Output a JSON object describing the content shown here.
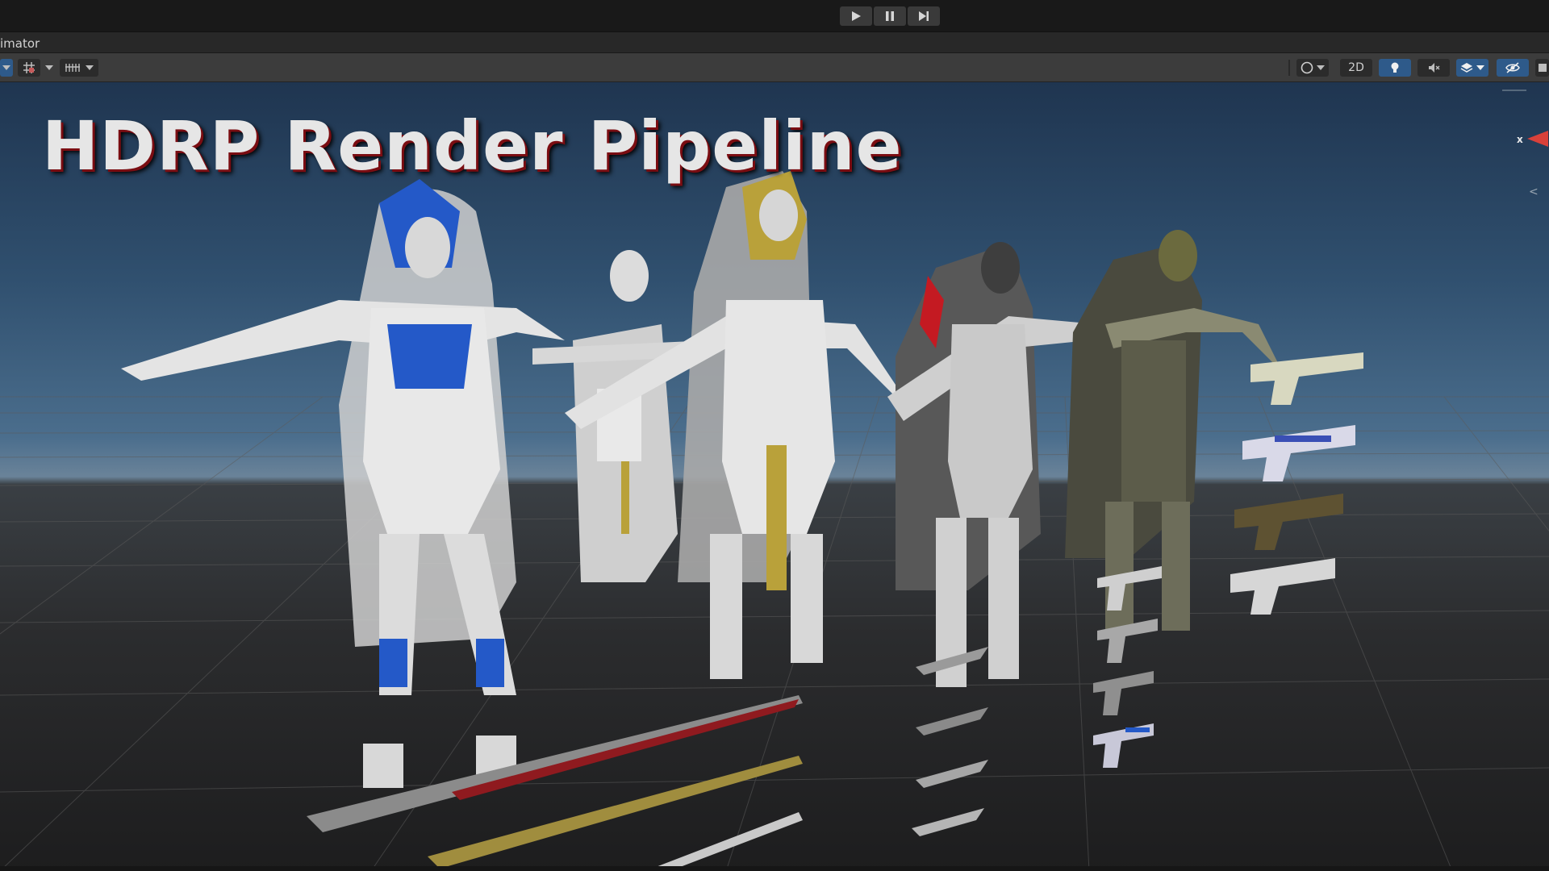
{
  "window": {
    "tab_label": "imator"
  },
  "playbar": {
    "buttons": [
      {
        "name": "play",
        "icon": "play-icon"
      },
      {
        "name": "pause",
        "icon": "pause-icon"
      },
      {
        "name": "step",
        "icon": "step-icon"
      }
    ]
  },
  "toolbar": {
    "left_tools": [
      "transform-icon",
      "grid-snap-icon",
      "increment-snap-icon"
    ],
    "mode_2d_label": "2D",
    "right_tools": [
      "shading-mode-icon",
      "lighting-icon",
      "audio-icon",
      "effects-icon",
      "scene-visibility-icon",
      "gizmos-icon"
    ]
  },
  "scene": {
    "headline": "HDRP Render Pipeline",
    "gizmo_axis_label": "x",
    "gizmo_back_label": "<",
    "colors": {
      "sky_top": "#1f3550",
      "horizon": "#6a8399",
      "ground": "#2b2c2e",
      "grid": "#5b5b5b",
      "headline_shadow": "#7a0d12",
      "accent_blue": "#2459c8",
      "accent_gold": "#b9a13a",
      "accent_red": "#c41a22"
    }
  }
}
